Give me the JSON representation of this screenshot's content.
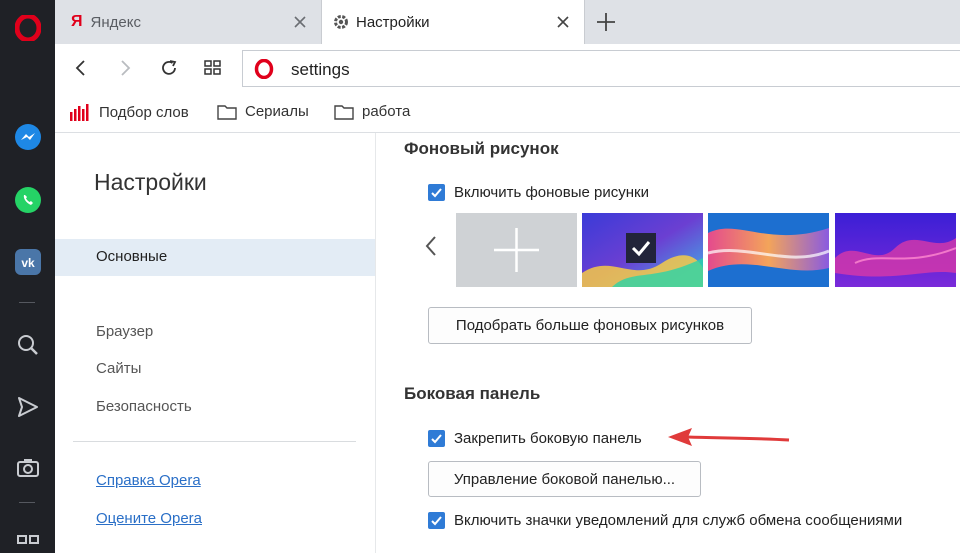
{
  "tabs": [
    {
      "label": "Яндекс"
    },
    {
      "label": "Настройки"
    }
  ],
  "address": {
    "url": "settings"
  },
  "bookmarks": [
    {
      "label": "Подбор слов"
    },
    {
      "label": "Сериалы"
    },
    {
      "label": "работа"
    }
  ],
  "sidebar_icons": [
    "opera-logo-icon",
    "messenger-icon",
    "whatsapp-icon",
    "vk-icon",
    "search-icon",
    "send-icon",
    "camera-icon",
    "apps-icon"
  ],
  "settings_nav": {
    "title": "Настройки",
    "active": "Основные",
    "items": [
      "Браузер",
      "Сайты",
      "Безопасность"
    ],
    "links": [
      "Справка Opera",
      "Оцените Opera"
    ]
  },
  "background_section": {
    "heading": "Фоновый рисунок",
    "checkbox_label": "Включить фоновые рисунки",
    "more_button": "Подобрать больше фоновых рисунков"
  },
  "sidebar_section": {
    "heading": "Боковая панель",
    "pin_label": "Закрепить боковую панель",
    "manage_button": "Управление боковой панелью...",
    "notify_label": "Включить значки уведомлений для служб обмена сообщениями"
  },
  "colors": {
    "opera_red": "#e0001b",
    "accent_blue": "#2f7bd6",
    "arrow_red": "#e03a3a"
  }
}
